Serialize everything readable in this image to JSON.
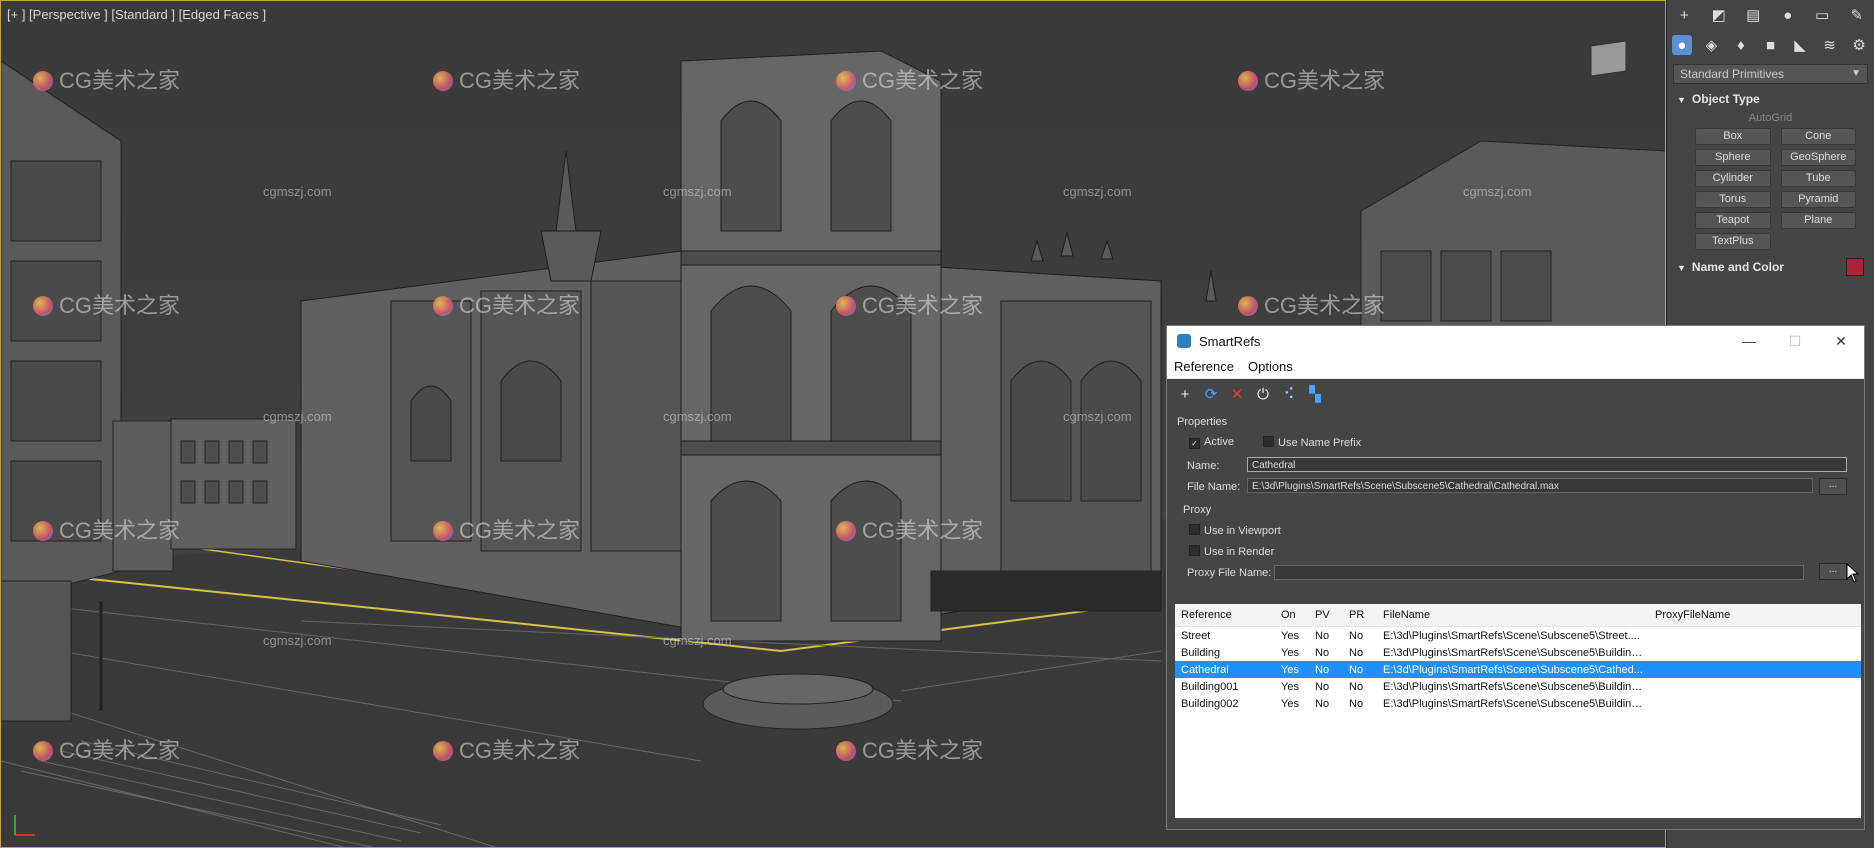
{
  "viewport": {
    "label": "[+ ] [Perspective ] [Standard ] [Edged Faces ]",
    "watermark_main": "CG美术之家",
    "watermark_small": "cgmszj.com"
  },
  "command_panel": {
    "top_tabs": [
      "create-icon",
      "modify-icon",
      "hierarchy-icon",
      "motion-icon",
      "display-icon",
      "utilities-icon"
    ],
    "sub_tabs": [
      "geometry-icon",
      "shapes-icon",
      "lights-icon",
      "cameras-icon",
      "helpers-icon",
      "spacewarps-icon",
      "systems-icon"
    ],
    "category": "Standard Primitives",
    "object_type_title": "Object Type",
    "autogrid": "AutoGrid",
    "objects": [
      "Box",
      "Cone",
      "Sphere",
      "GeoSphere",
      "Cylinder",
      "Tube",
      "Torus",
      "Pyramid",
      "Teapot",
      "Plane",
      "TextPlus"
    ],
    "name_color_title": "Name and Color",
    "accent_color": "#b0203a"
  },
  "smartrefs": {
    "title": "SmartRefs",
    "menu": [
      "Reference",
      "Options"
    ],
    "toolbar": [
      "add-icon",
      "refresh-icon",
      "delete-icon",
      "power-icon",
      "move-icon",
      "proxy-icon"
    ],
    "properties_label": "Properties",
    "active_label": "Active",
    "use_name_prefix_label": "Use Name Prefix",
    "name_label": "Name:",
    "name_value": "Cathedral",
    "file_name_label": "File Name:",
    "file_name_value": "E:\\3d\\Plugins\\SmartRefs\\Scene\\Subscene5\\Cathedral\\Cathedral.max",
    "browse_label": "...",
    "proxy_label": "Proxy",
    "use_in_viewport_label": "Use in Viewport",
    "use_in_render_label": "Use in Render",
    "proxy_file_name_label": "Proxy File Name:",
    "proxy_file_name_value": "",
    "table": {
      "columns": [
        "Reference",
        "On",
        "PV",
        "PR",
        "FileName",
        "ProxyFileName"
      ],
      "rows": [
        [
          "Street",
          "Yes",
          "No",
          "No",
          "E:\\3d\\Plugins\\SmartRefs\\Scene\\Subscene5\\Street....",
          ""
        ],
        [
          "Building",
          "Yes",
          "No",
          "No",
          "E:\\3d\\Plugins\\SmartRefs\\Scene\\Subscene5\\Building...",
          ""
        ],
        [
          "Cathedral",
          "Yes",
          "No",
          "No",
          "E:\\3d\\Plugins\\SmartRefs\\Scene\\Subscene5\\Cathed...",
          ""
        ],
        [
          "Building001",
          "Yes",
          "No",
          "No",
          "E:\\3d\\Plugins\\SmartRefs\\Scene\\Subscene5\\Building...",
          ""
        ],
        [
          "Building002",
          "Yes",
          "No",
          "No",
          "E:\\3d\\Plugins\\SmartRefs\\Scene\\Subscene5\\Building...",
          ""
        ]
      ],
      "selected_row": 2
    }
  }
}
